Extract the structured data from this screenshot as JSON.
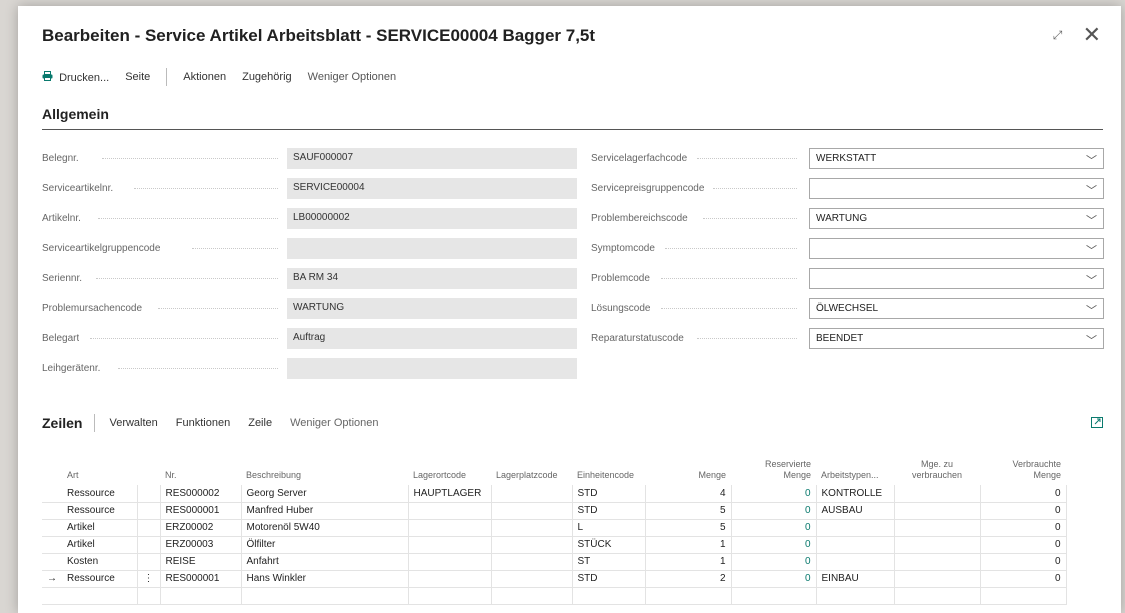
{
  "window": {
    "title": "Bearbeiten - Service Artikel Arbeitsblatt - SERVICE00004 Bagger 7,5t",
    "expand_glyph": "⤢",
    "close_glyph": "✕"
  },
  "actionbar": {
    "print_label": "Drucken...",
    "items": [
      "Seite",
      "Aktionen",
      "Zugehörig",
      "Weniger Optionen"
    ]
  },
  "general": {
    "section_title": "Allgemein",
    "left_fields": [
      {
        "label": "Belegnr.",
        "value": "SAUF000007"
      },
      {
        "label": "Serviceartikelnr.",
        "value": "SERVICE00004"
      },
      {
        "label": "Artikelnr.",
        "value": "LB00000002"
      },
      {
        "label": "Serviceartikelgruppencode",
        "value": ""
      },
      {
        "label": "Seriennr.",
        "value": "BA RM 34"
      },
      {
        "label": "Problemursachencode",
        "value": "WARTUNG"
      },
      {
        "label": "Belegart",
        "value": "Auftrag"
      },
      {
        "label": "Leihgerätenr.",
        "value": ""
      }
    ],
    "right_fields": [
      {
        "label": "Servicelagerfachcode",
        "value": "WERKSTATT"
      },
      {
        "label": "Servicepreisgruppencode",
        "value": ""
      },
      {
        "label": "Problembereichscode",
        "value": "WARTUNG"
      },
      {
        "label": "Symptomcode",
        "value": ""
      },
      {
        "label": "Problemcode",
        "value": ""
      },
      {
        "label": "Lösungscode",
        "value": "ÖLWECHSEL"
      },
      {
        "label": "Reparaturstatuscode",
        "value": "BEENDET"
      }
    ]
  },
  "lines": {
    "title": "Zeilen",
    "actions": [
      "Verwalten",
      "Funktionen",
      "Zeile",
      "Weniger Optionen"
    ],
    "columns": [
      "Art",
      "Nr.",
      "Beschreibung",
      "Lagerortcode",
      "Lagerplatzcode",
      "Einheitencode",
      "Menge",
      "Reservierte Menge",
      "Arbeitstypen...",
      "Mge. zu verbrauchen",
      "Verbrauchte Menge"
    ],
    "rows": [
      {
        "art": "Ressource",
        "nr": "RES000002",
        "beschreibung": "Georg Server",
        "lagerort": "HAUPTLAGER",
        "lagerplatz": "",
        "einheit": "STD",
        "menge": "4",
        "reserviert": "0",
        "arbeitstyp": "KONTROLLE",
        "mge_verbrauchen": "",
        "verbraucht": "0"
      },
      {
        "art": "Ressource",
        "nr": "RES000001",
        "beschreibung": "Manfred Huber",
        "lagerort": "",
        "lagerplatz": "",
        "einheit": "STD",
        "menge": "5",
        "reserviert": "0",
        "arbeitstyp": "AUSBAU",
        "mge_verbrauchen": "",
        "verbraucht": "0"
      },
      {
        "art": "Artikel",
        "nr": "ERZ00002",
        "beschreibung": "Motorenöl 5W40",
        "lagerort": "",
        "lagerplatz": "",
        "einheit": "L",
        "menge": "5",
        "reserviert": "0",
        "arbeitstyp": "",
        "mge_verbrauchen": "",
        "verbraucht": "0"
      },
      {
        "art": "Artikel",
        "nr": "ERZ00003",
        "beschreibung": "Ölfilter",
        "lagerort": "",
        "lagerplatz": "",
        "einheit": "STÜCK",
        "menge": "1",
        "reserviert": "0",
        "arbeitstyp": "",
        "mge_verbrauchen": "",
        "verbraucht": "0"
      },
      {
        "art": "Kosten",
        "nr": "REISE",
        "beschreibung": "Anfahrt",
        "lagerort": "",
        "lagerplatz": "",
        "einheit": "ST",
        "menge": "1",
        "reserviert": "0",
        "arbeitstyp": "",
        "mge_verbrauchen": "",
        "verbraucht": "0"
      },
      {
        "art": "Ressource",
        "nr": "RES000001",
        "beschreibung": "Hans Winkler",
        "lagerort": "",
        "lagerplatz": "",
        "einheit": "STD",
        "menge": "2",
        "reserviert": "0",
        "arbeitstyp": "EINBAU",
        "mge_verbrauchen": "",
        "verbraucht": "0"
      }
    ],
    "active_row": 5,
    "active_arrow": "→",
    "row_menu_glyph": "⋮"
  },
  "colors": {
    "accent": "#0a7a6e",
    "readonly_bg": "#e6e6e6"
  }
}
